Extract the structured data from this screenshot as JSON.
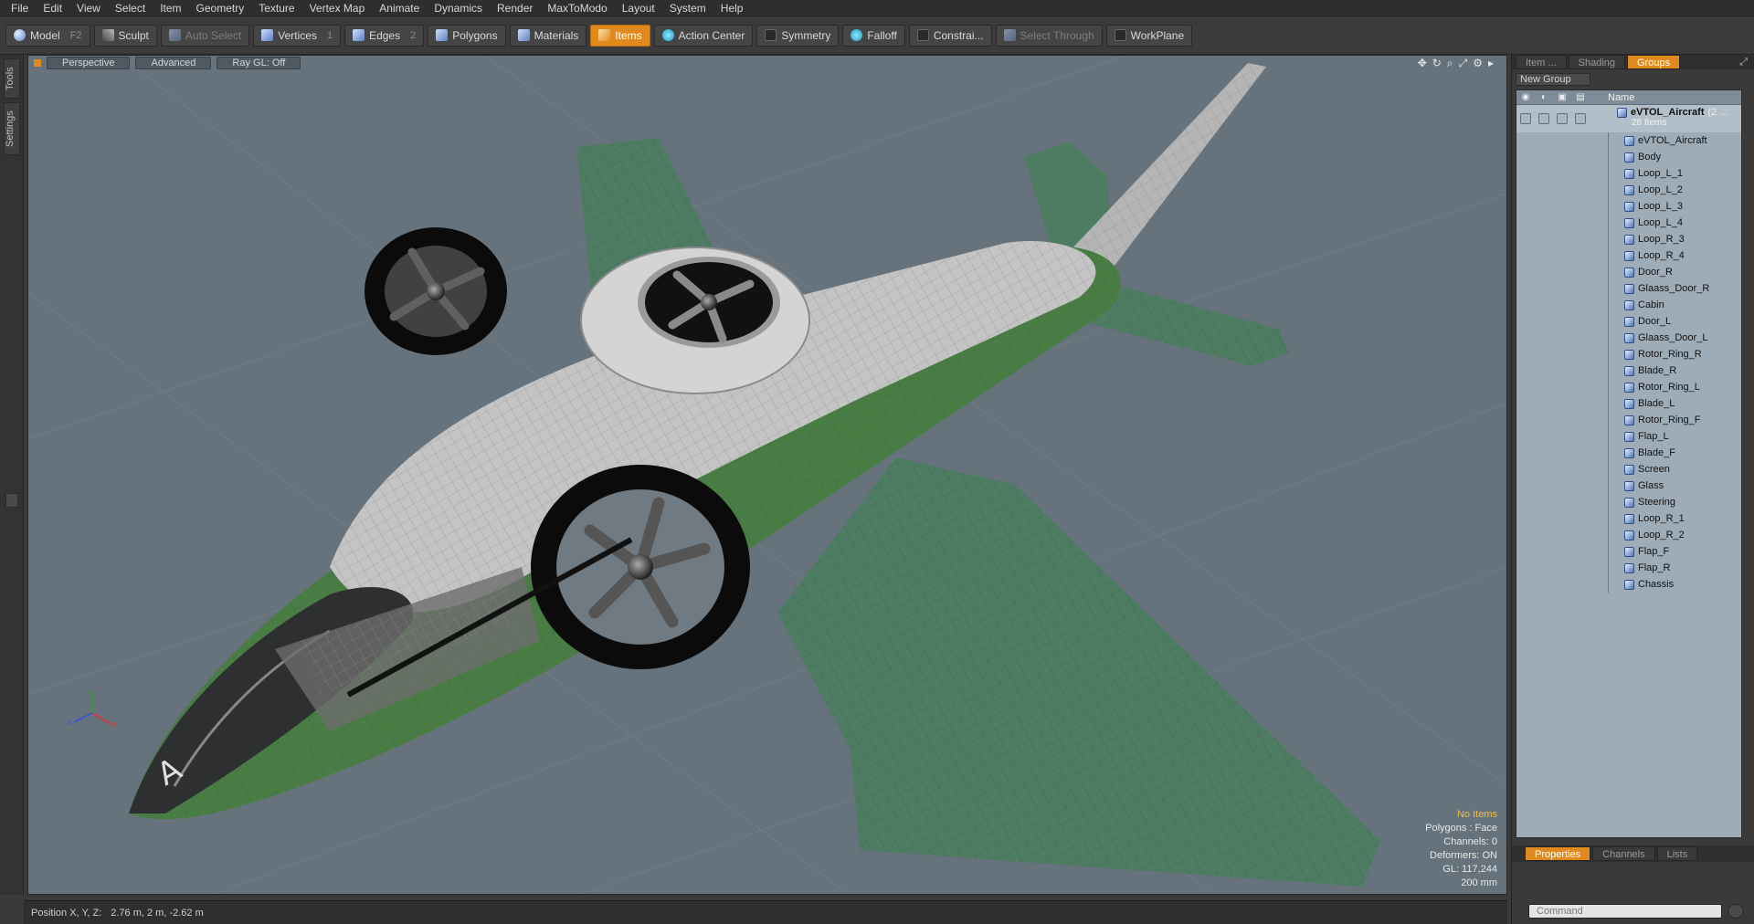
{
  "menu": [
    "File",
    "Edit",
    "View",
    "Select",
    "Item",
    "Geometry",
    "Texture",
    "Vertex Map",
    "Animate",
    "Dynamics",
    "Render",
    "MaxToModo",
    "Layout",
    "System",
    "Help"
  ],
  "toolbar": {
    "model": "Model",
    "model_key": "F2",
    "sculpt": "Sculpt",
    "auto_select": "Auto Select",
    "vertices": "Vertices",
    "vertices_key": "1",
    "edges": "Edges",
    "edges_key": "2",
    "polygons": "Polygons",
    "materials": "Materials",
    "items": "Items",
    "action_center": "Action Center",
    "symmetry": "Symmetry",
    "falloff": "Falloff",
    "constraints": "Constrai...",
    "select_through": "Select Through",
    "workplane": "WorkPlane"
  },
  "left_tabs": [
    "Tools",
    "Settings"
  ],
  "viewport": {
    "perspective": "Perspective",
    "advanced": "Advanced",
    "ray_gl": "Ray GL: Off",
    "hud": {
      "selection": "No Items",
      "polygons": "Polygons : Face",
      "channels": "Channels: 0",
      "deformers": "Deformers: ON",
      "gl": "GL: 117,244",
      "scale": "200 mm"
    },
    "colors": {
      "bg": "#66737d",
      "wing": "#4e7c62",
      "body": "#c2c2c2",
      "rotor": "#0b0b0b"
    }
  },
  "status": {
    "label": "Position X, Y, Z:",
    "value": "2.76 m, 2 m, -2.62 m"
  },
  "right_panel": {
    "tabs": [
      "Item ...",
      "Shading",
      "Groups"
    ],
    "new_group": "New Group",
    "column_name": "Name",
    "root": {
      "name": "eVTOL_Aircraft",
      "suffix": "(2 ...",
      "count": "28 Items"
    },
    "items": [
      "eVTOL_Aircraft",
      "Body",
      "Loop_L_1",
      "Loop_L_2",
      "Loop_L_3",
      "Loop_L_4",
      "Loop_R_3",
      "Loop_R_4",
      "Door_R",
      "Glaass_Door_R",
      "Cabin",
      "Door_L",
      "Glaass_Door_L",
      "Rotor_Ring_R",
      "Blade_R",
      "Rotor_Ring_L",
      "Blade_L",
      "Rotor_Ring_F",
      "Flap_L",
      "Blade_F",
      "Screen",
      "Glass",
      "Steering",
      "Loop_R_1",
      "Loop_R_2",
      "Flap_F",
      "Flap_R",
      "Chassis"
    ],
    "bottom_tabs": [
      "Properties",
      "Channels",
      "Lists"
    ],
    "command_placeholder": "Command"
  }
}
